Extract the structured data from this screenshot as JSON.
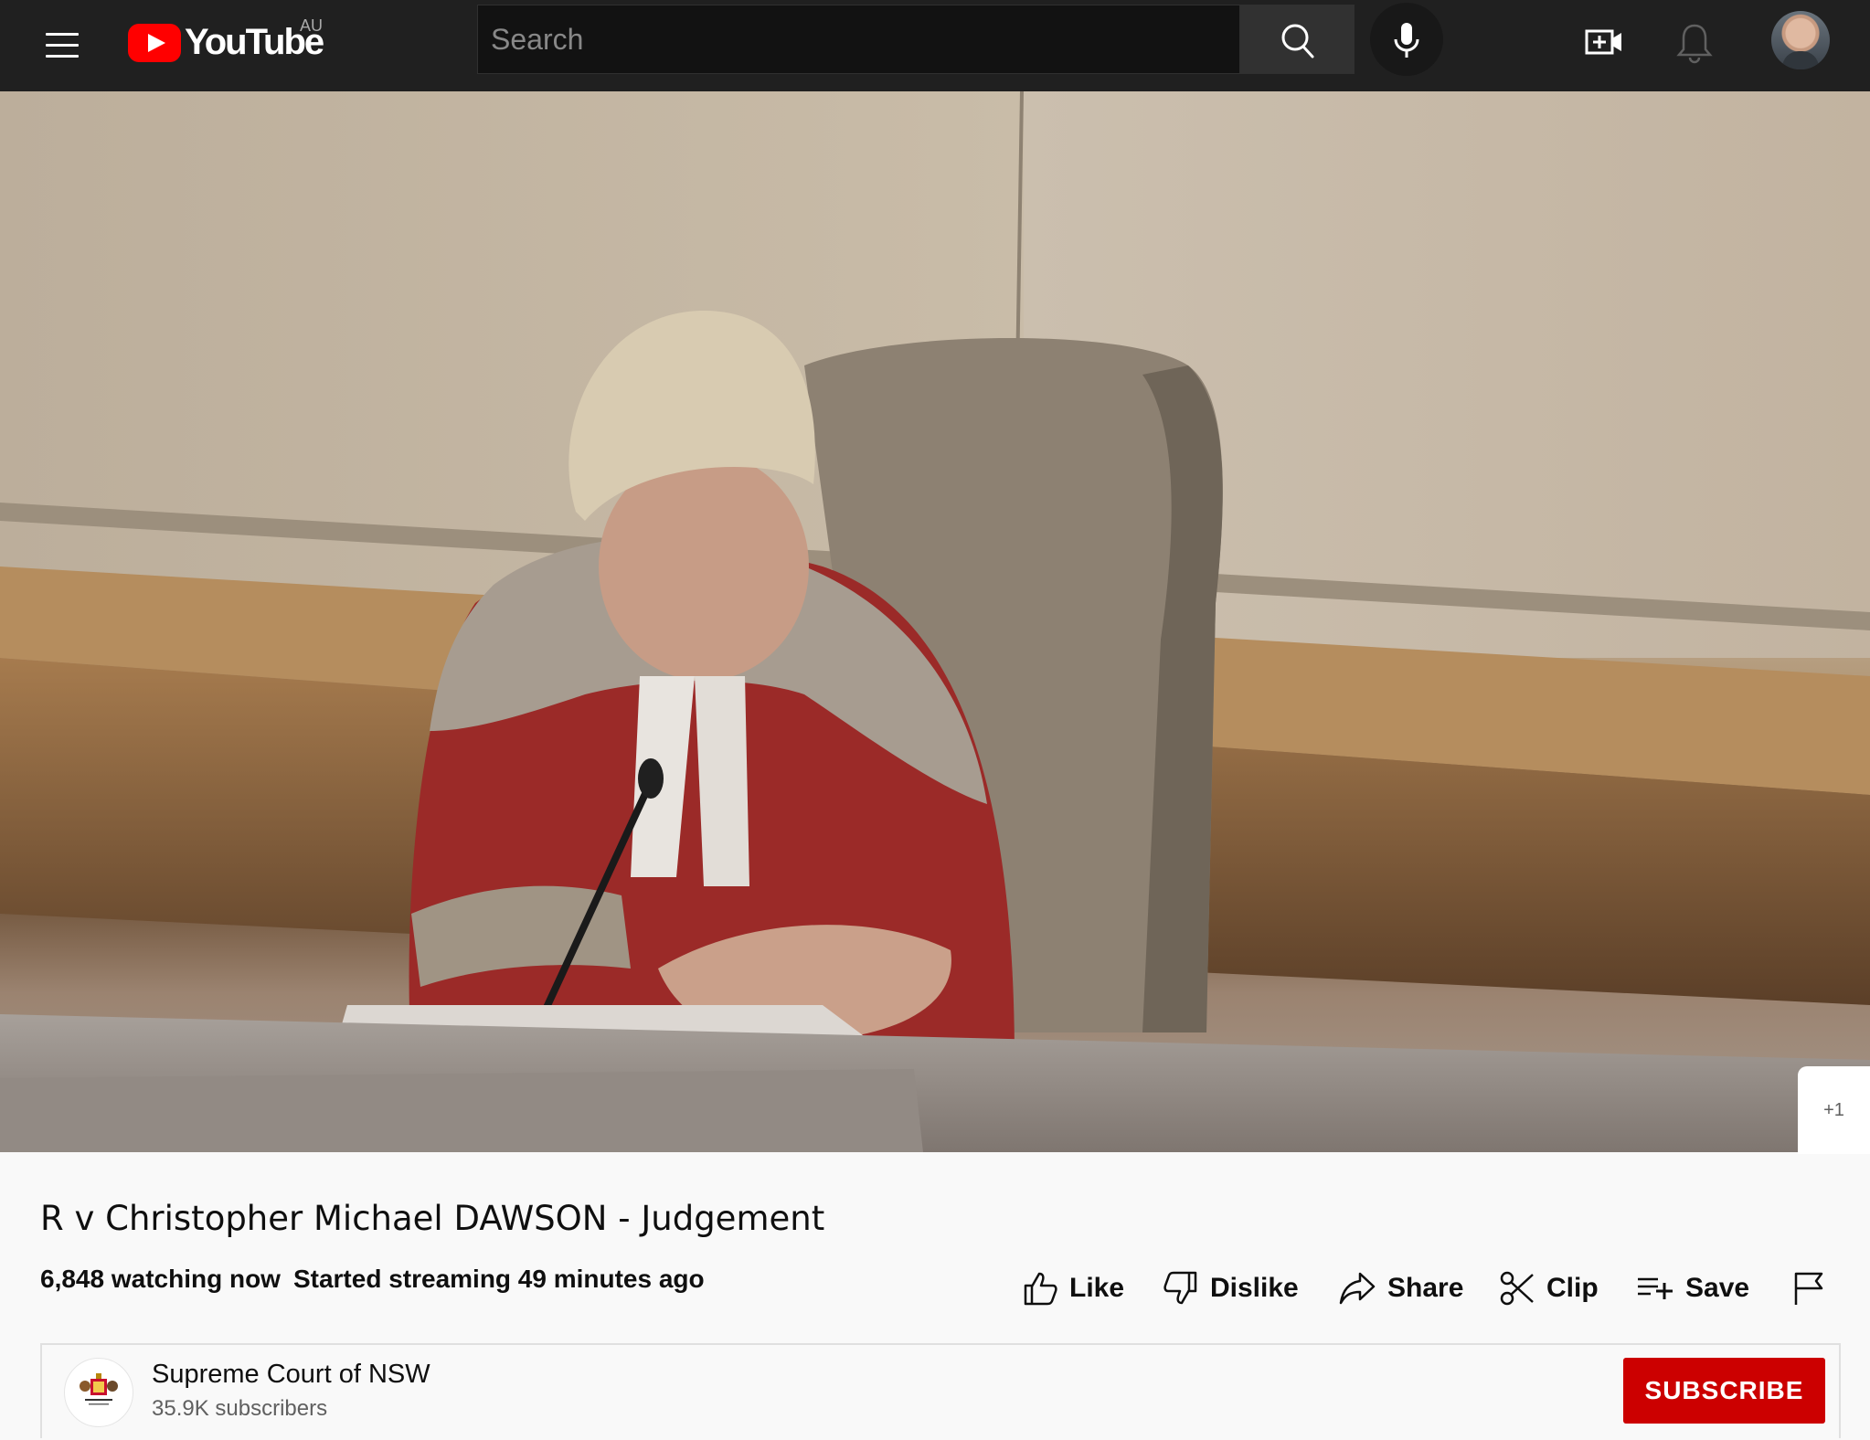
{
  "header": {
    "logo_text": "YouTube",
    "region": "AU",
    "search_placeholder": "Search"
  },
  "video": {
    "badge": "+1"
  },
  "info": {
    "title": "R v Christopher Michael DAWSON - Judgement",
    "watching": "6,848 watching now",
    "started": "Started streaming 49 minutes ago"
  },
  "actions": {
    "like": "Like",
    "dislike": "Dislike",
    "share": "Share",
    "clip": "Clip",
    "save": "Save"
  },
  "channel": {
    "name": "Supreme Court of NSW",
    "subscribers": "35.9K subscribers",
    "subscribe_label": "SUBSCRIBE"
  },
  "colors": {
    "topbar": "#202020",
    "brand_red": "#ff0000",
    "subscribe_red": "#cc0000",
    "page_bg": "#f9f9f9"
  },
  "icons": [
    "menu-icon",
    "youtube-logo-icon",
    "search-icon",
    "mic-icon",
    "create-video-icon",
    "bell-icon",
    "like-icon",
    "dislike-icon",
    "share-icon",
    "clip-icon",
    "save-playlist-icon",
    "report-flag-icon"
  ]
}
